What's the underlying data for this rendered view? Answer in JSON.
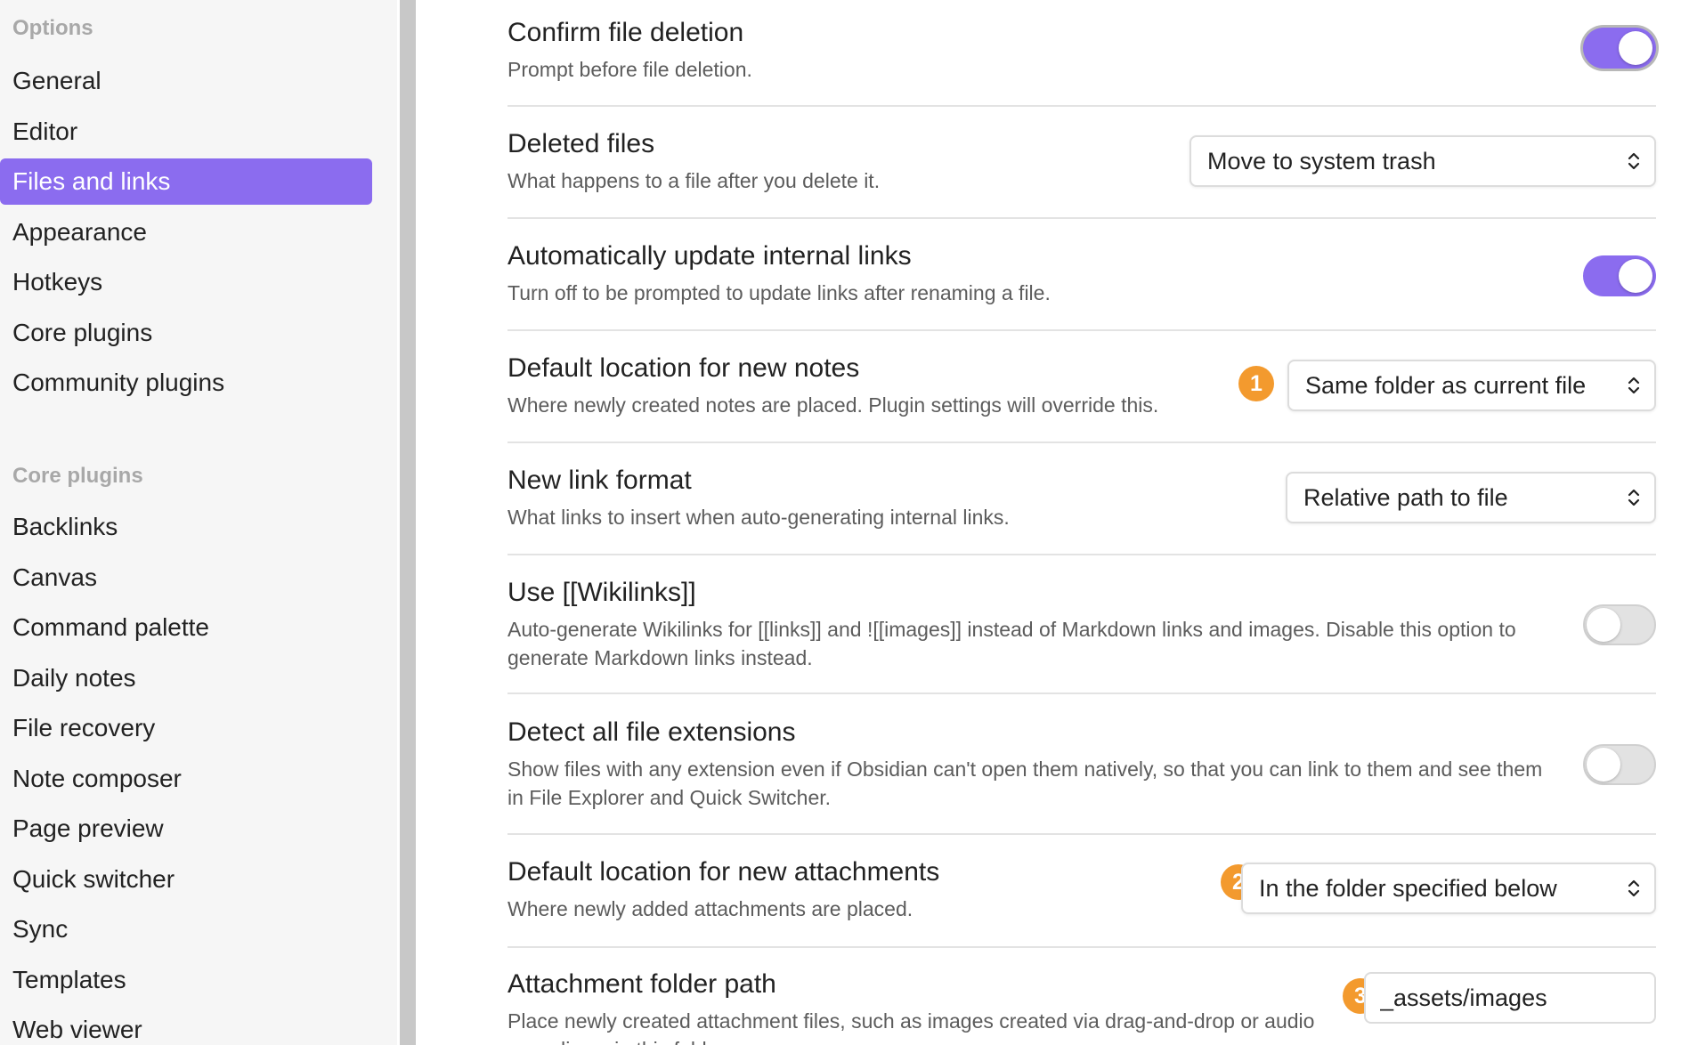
{
  "sidebar": {
    "options_title": "Options",
    "options_items": [
      {
        "label": "General"
      },
      {
        "label": "Editor"
      },
      {
        "label": "Files and links"
      },
      {
        "label": "Appearance"
      },
      {
        "label": "Hotkeys"
      },
      {
        "label": "Core plugins"
      },
      {
        "label": "Community plugins"
      }
    ],
    "core_title": "Core plugins",
    "core_items": [
      {
        "label": "Backlinks"
      },
      {
        "label": "Canvas"
      },
      {
        "label": "Command palette"
      },
      {
        "label": "Daily notes"
      },
      {
        "label": "File recovery"
      },
      {
        "label": "Note composer"
      },
      {
        "label": "Page preview"
      },
      {
        "label": "Quick switcher"
      },
      {
        "label": "Sync"
      },
      {
        "label": "Templates"
      },
      {
        "label": "Web viewer"
      }
    ],
    "active_item": "Files and links"
  },
  "settings": [
    {
      "name": "Confirm file deletion",
      "desc": "Prompt before file deletion.",
      "control": "toggle",
      "state": "on"
    },
    {
      "name": "Deleted files",
      "desc": "What happens to a file after you delete it.",
      "control": "dropdown",
      "value": "Move to system trash"
    },
    {
      "name": "Automatically update internal links",
      "desc": "Turn off to be prompted to update links after renaming a file.",
      "control": "toggle",
      "state": "on"
    },
    {
      "name": "Default location for new notes",
      "desc": "Where newly created notes are placed. Plugin settings will override this.",
      "control": "dropdown",
      "value": "Same folder as current file",
      "badge": "1"
    },
    {
      "name": "New link format",
      "desc": "What links to insert when auto-generating internal links.",
      "control": "dropdown",
      "value": "Relative path to file"
    },
    {
      "name": "Use [[Wikilinks]]",
      "desc": "Auto-generate Wikilinks for [[links]] and ![[images]] instead of Markdown links and images. Disable this option to generate Markdown links instead.",
      "control": "toggle",
      "state": "off"
    },
    {
      "name": "Detect all file extensions",
      "desc": "Show files with any extension even if Obsidian can't open them natively, so that you can link to them and see them in File Explorer and Quick Switcher.",
      "control": "toggle",
      "state": "off"
    },
    {
      "name": "Default location for new attachments",
      "desc": "Where newly added attachments are placed.",
      "control": "dropdown",
      "value": "In the folder specified below",
      "badge": "2"
    },
    {
      "name": "Attachment folder path",
      "desc": "Place newly created attachment files, such as images created via drag-and-drop or audio recordings, in this folder.",
      "control": "text",
      "value": "_assets/images",
      "badge": "3"
    }
  ],
  "colors": {
    "accent": "#8b6cef",
    "badge": "#f39a2e"
  }
}
